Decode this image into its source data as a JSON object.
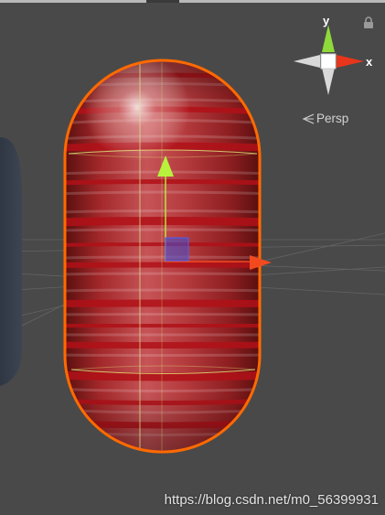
{
  "scene_view": {
    "background_color": "#494949",
    "selected_object": {
      "shape": "capsule",
      "material": "red-wood-stripes",
      "outline_color": "#ff6a00"
    },
    "move_gizmo": {
      "y_axis_color": "#b8f23c",
      "x_axis_color": "#f24a1e",
      "plane_handle_color": "#3b4fd8"
    }
  },
  "orientation_gizmo": {
    "y_label": "y",
    "x_label": "x",
    "y_color": "#8fd93a",
    "x_color": "#e8361c",
    "neutral_color": "#d9d9d9"
  },
  "projection": {
    "label": "Persp",
    "icon": "perspective-icon"
  },
  "lock": {
    "icon": "lock-icon"
  },
  "watermark": {
    "text": "https://blog.csdn.net/m0_56399931"
  }
}
